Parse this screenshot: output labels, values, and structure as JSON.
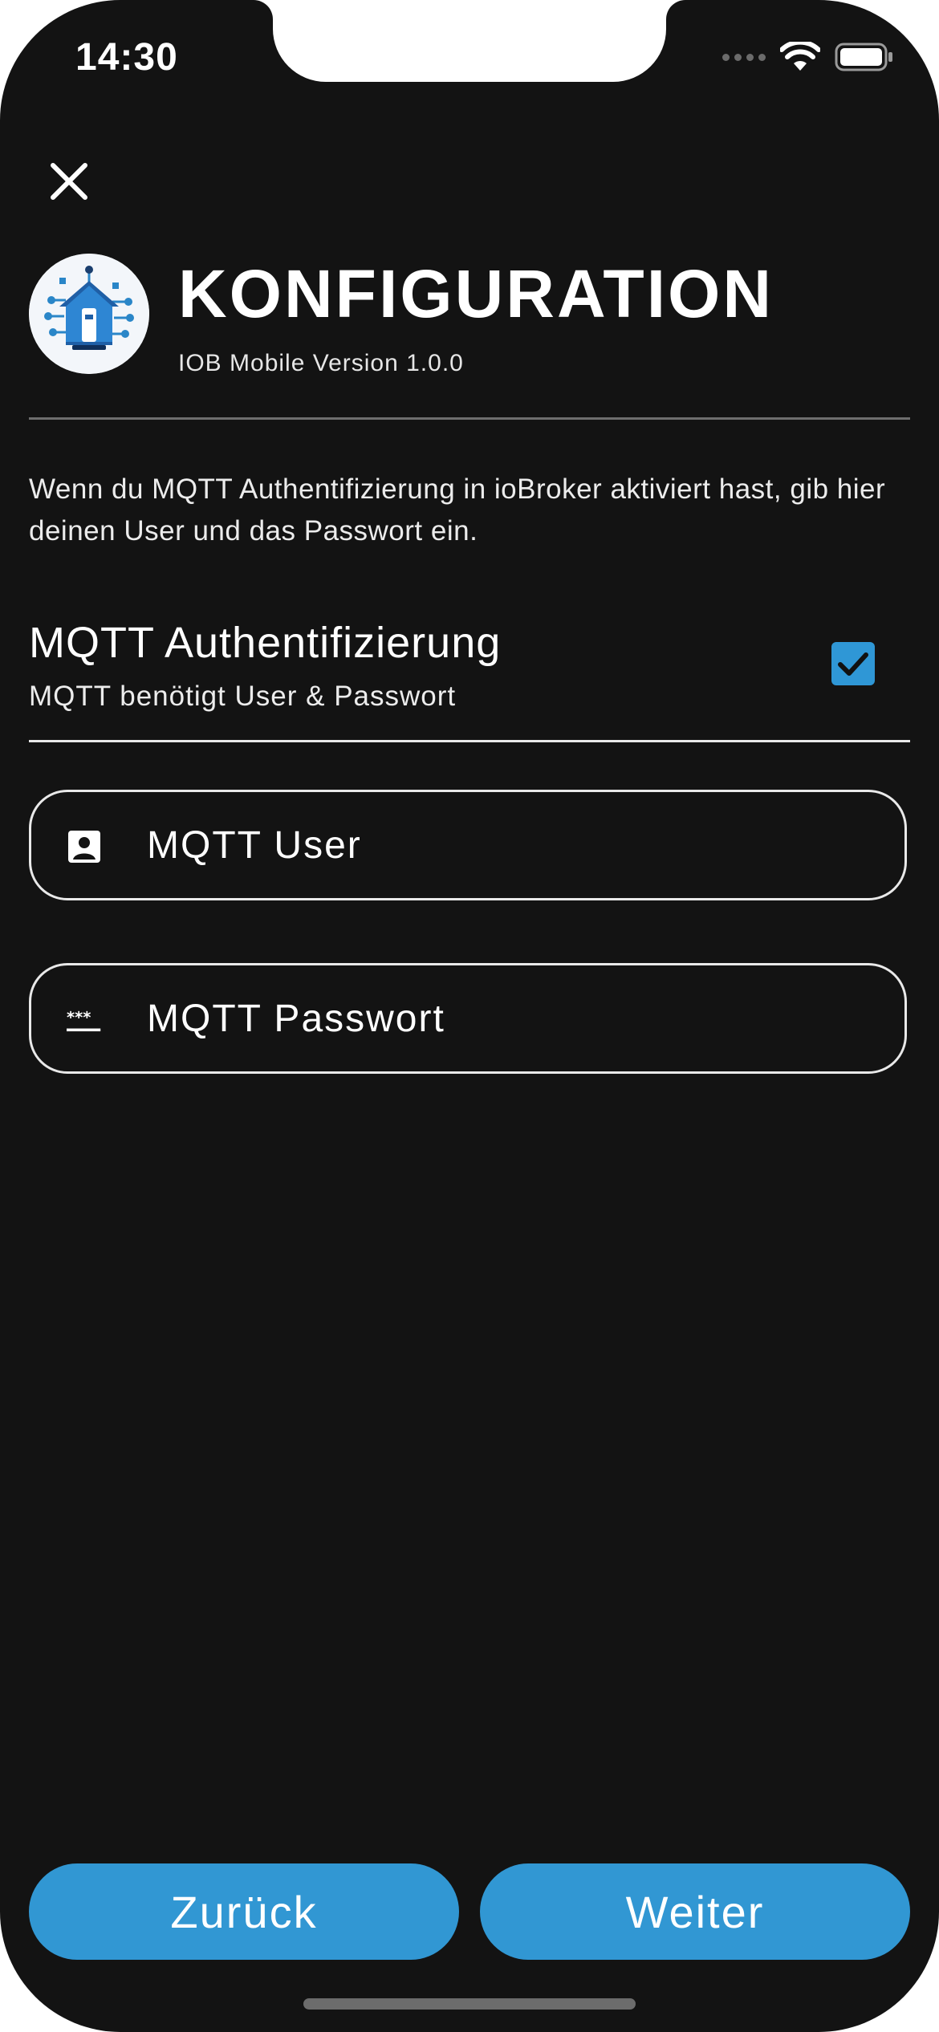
{
  "status_bar": {
    "time": "14:30",
    "icons": [
      "signal-dots-icon",
      "wifi-icon",
      "battery-icon"
    ]
  },
  "header": {
    "close_icon": "close-icon",
    "logo_icon": "iobroker-home-logo",
    "title": "KONFIGURATION",
    "version": "IOB Mobile Version 1.0.0"
  },
  "intro": {
    "text": "Wenn du MQTT Authentifizierung in ioBroker aktiviert hast, gib hier deinen User und das Passwort ein."
  },
  "auth_toggle": {
    "title": "MQTT Authentifizierung",
    "subtitle": "MQTT benötigt User & Passwort",
    "checked": true
  },
  "fields": {
    "user": {
      "icon": "account-box-icon",
      "placeholder": "MQTT User",
      "value": ""
    },
    "password": {
      "icon": "password-asterisks-icon",
      "placeholder": "MQTT Passwort",
      "value": ""
    }
  },
  "buttons": {
    "back_label": "Zurück",
    "next_label": "Weiter"
  },
  "colors": {
    "background": "#131313",
    "accent": "#3197d3",
    "text": "#ffffff",
    "divider": "#6e6e6e"
  }
}
